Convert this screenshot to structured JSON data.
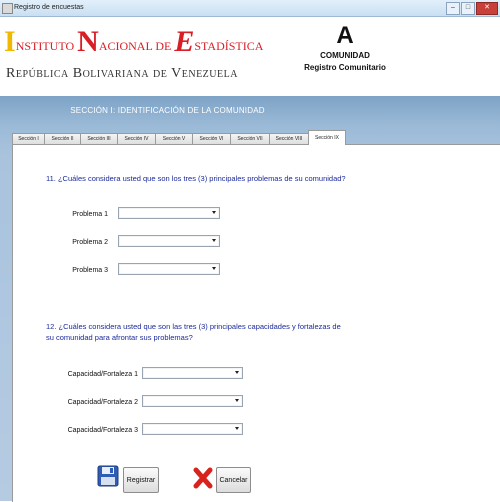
{
  "window": {
    "title": "Registro de encuestas",
    "controls": [
      "minimize-icon",
      "maximize-icon",
      "close-icon"
    ]
  },
  "header": {
    "logo_line1": {
      "initial_i": "I",
      "word_instituto": "NSTITUTO",
      "initial_n": "N",
      "word_nacional": "ACIONAL DE",
      "initial_e": "E",
      "word_estadistica": "STADÍSTICA"
    },
    "logo_line2": "República Bolivariana de Venezuela",
    "form_letter": "A",
    "form_kind": "COMUNIDAD",
    "form_type": "Registro Comunitario"
  },
  "panel": {
    "section_title": "SECCIÓN I: IDENTIFICACIÓN DE LA COMUNIDAD",
    "tabs": [
      {
        "label": "Sección I"
      },
      {
        "label": "Sección II"
      },
      {
        "label": "Sección III"
      },
      {
        "label": "Sección IV"
      },
      {
        "label": "Sección V"
      },
      {
        "label": "Sección VI"
      },
      {
        "label": "Sección VII"
      },
      {
        "label": "Sección VIII"
      },
      {
        "label": "Sección IX"
      }
    ],
    "active_tab": "Sección IX"
  },
  "question11": {
    "text": "11. ¿Cuáles considera usted que son los tres (3) principales problemas de su comunidad?",
    "fields": [
      {
        "label": "Problema 1",
        "value": ""
      },
      {
        "label": "Problema 2",
        "value": ""
      },
      {
        "label": "Problema 3",
        "value": ""
      }
    ]
  },
  "question12": {
    "text": "12. ¿Cuáles considera usted que son las tres (3) principales capacidades y fortalezas de su comunidad para afrontar sus problemas?",
    "fields": [
      {
        "label": "Capacidad/Fortaleza 1",
        "value": ""
      },
      {
        "label": "Capacidad/Fortaleza 2",
        "value": ""
      },
      {
        "label": "Capacidad/Fortaleza 3",
        "value": ""
      }
    ]
  },
  "actions": {
    "save_label": "Registrar",
    "cancel_label": "Cancelar"
  },
  "colors": {
    "question_text": "#1b2a9a",
    "panel_top": "#7ea3c6",
    "panel_bottom": "#b5cbe2",
    "logo_red": "#d91f26",
    "logo_yellow": "#f0b800",
    "save_icon": "#2f5db5",
    "cancel_icon": "#d8221c"
  }
}
